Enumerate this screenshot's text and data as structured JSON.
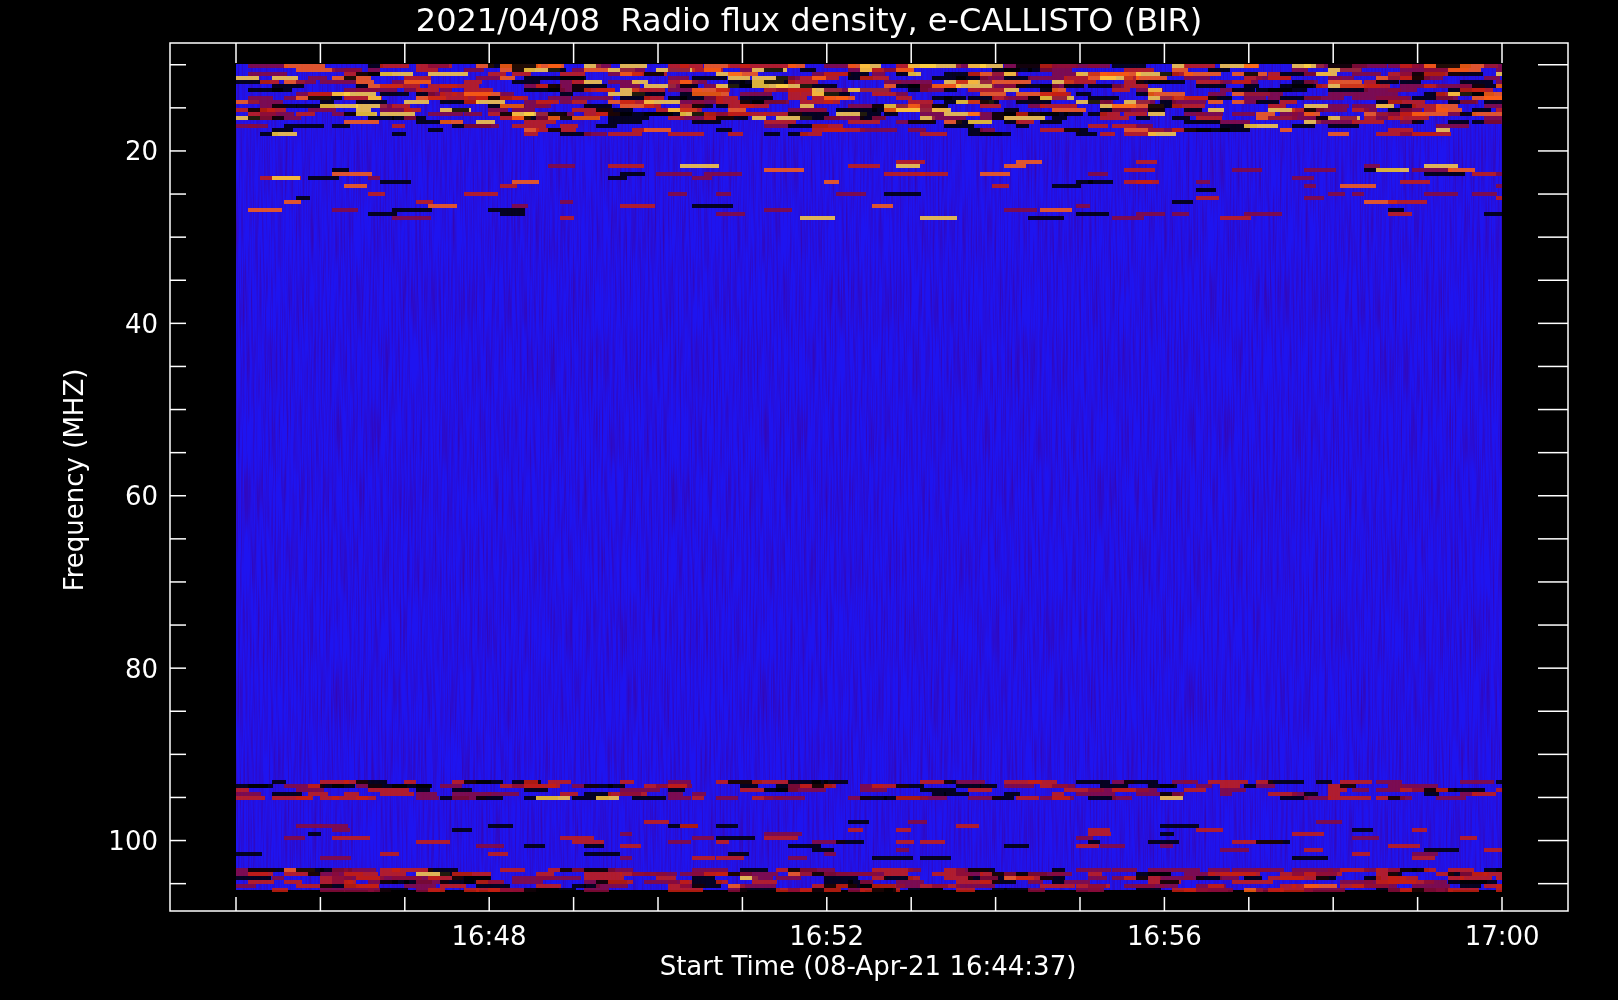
{
  "title": "2021/04/08  Radio flux density, e-CALLISTO (BIR)",
  "ylabel": "Frequency (MHZ)",
  "xlabel": "Start Time (08-Apr-21 16:44:37)",
  "yticks": [
    "20",
    "40",
    "60",
    "80",
    "100"
  ],
  "xticks": [
    "16:48",
    "16:52",
    "16:56",
    "17:00"
  ]
}
